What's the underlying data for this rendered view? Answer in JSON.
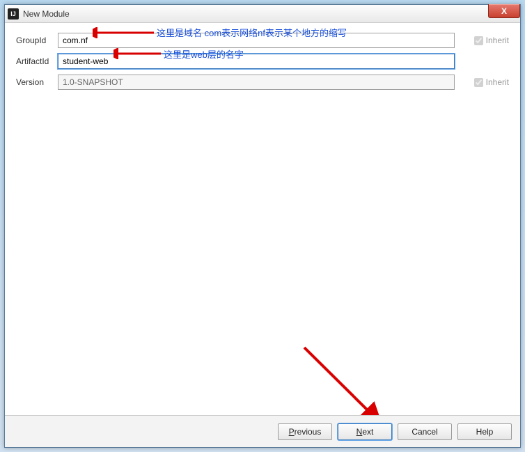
{
  "window": {
    "title": "New Module",
    "icon_text": "IJ"
  },
  "form": {
    "groupid_label": "GroupId",
    "groupid_value": "com.nf",
    "artifactid_label": "ArtifactId",
    "artifactid_value": "student-web",
    "version_label": "Version",
    "version_value": "1.0-SNAPSHOT",
    "inherit_label": "Inherit"
  },
  "annotations": {
    "groupid_note": "这里是域名 com表示网络nf表示某个地方的缩写",
    "artifactid_note": "这里是web层的名字"
  },
  "footer": {
    "previous": "Previous",
    "next": "Next",
    "cancel": "Cancel",
    "help": "Help"
  },
  "close_x": "X"
}
